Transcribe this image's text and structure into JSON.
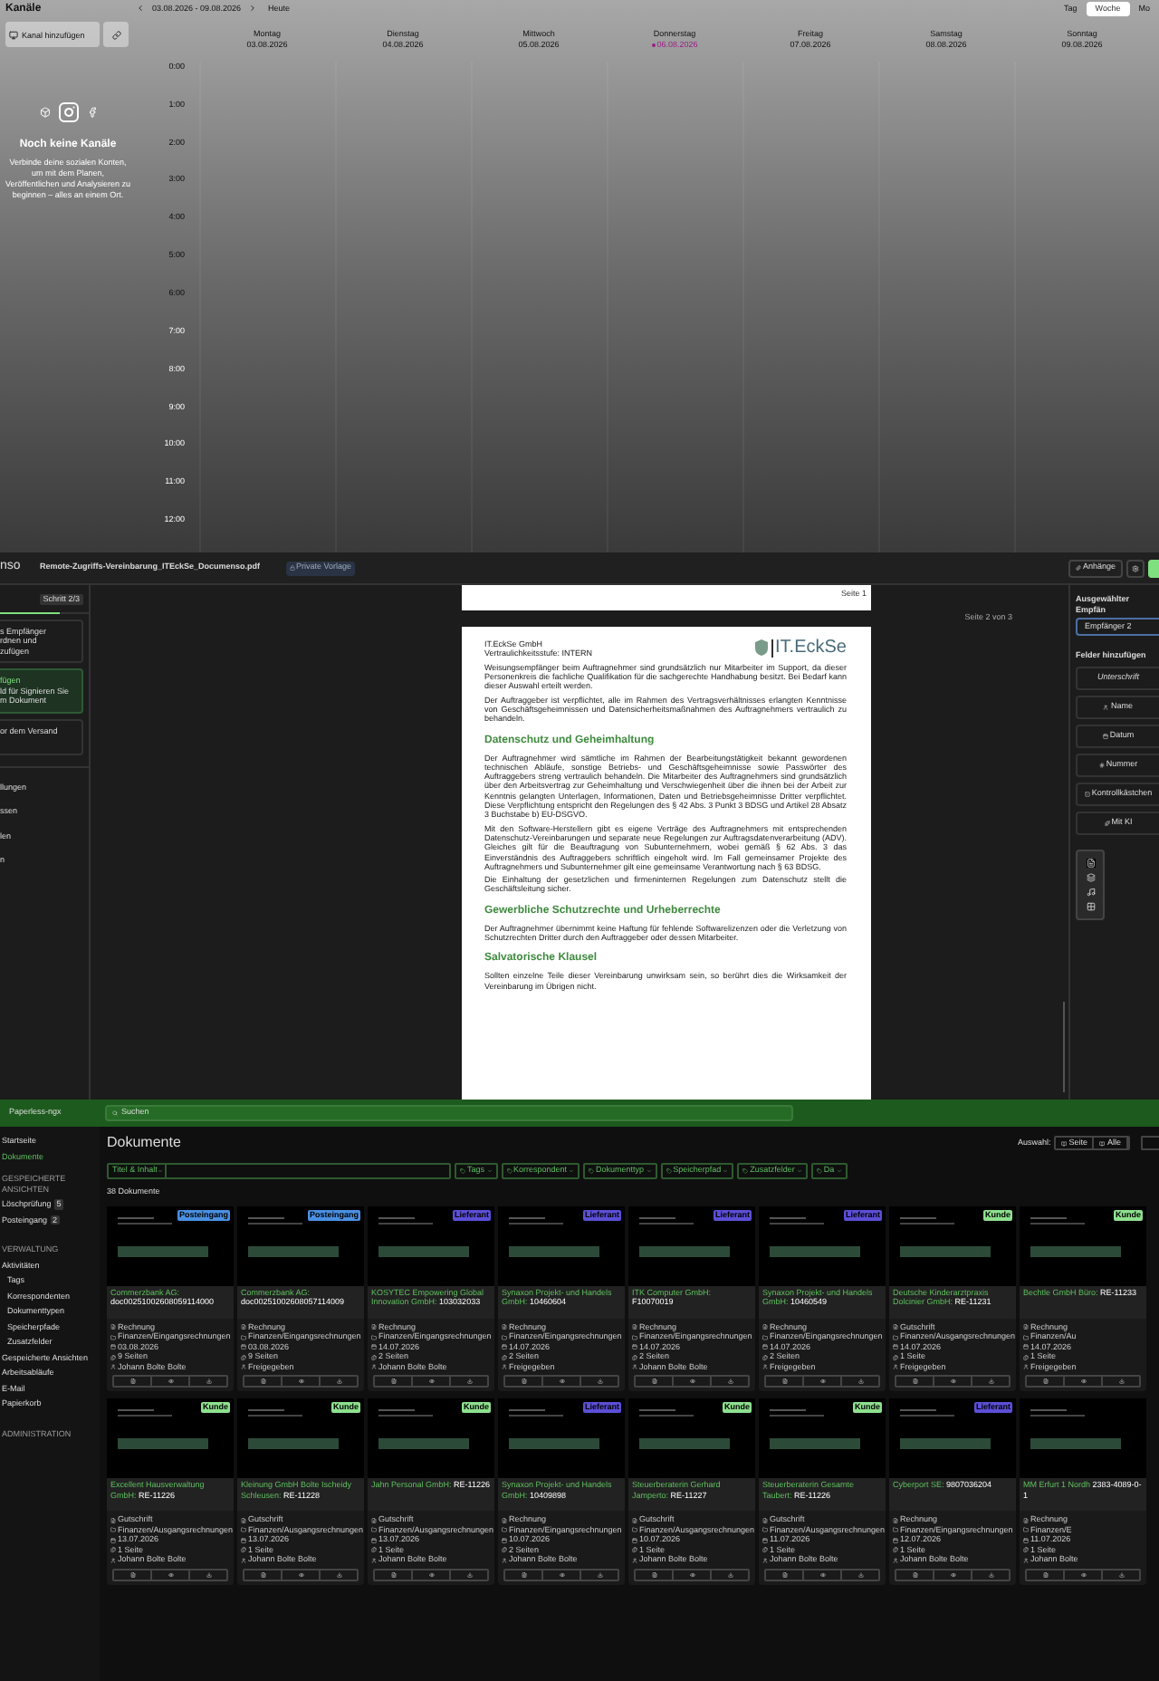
{
  "calendar": {
    "sidebar": {
      "title": "Kanäle",
      "add_button": "Kanal hinzufügen",
      "empty_title": "Noch keine Kanäle",
      "empty_text": "Verbinde deine sozialen Konten, um mit dem Planen, Veröffentlichen und Analysieren zu beginnen – alles an einem Ort."
    },
    "range": "03.08.2026 - 09.08.2026",
    "today_button": "Heute",
    "views": [
      {
        "label": "Tag",
        "selected": false
      },
      {
        "label": "Woche",
        "selected": true
      },
      {
        "label": "Mo",
        "selected": false
      }
    ],
    "days": [
      {
        "name": "Montag",
        "date": "03.08.2026",
        "today": false
      },
      {
        "name": "Dienstag",
        "date": "04.08.2026",
        "today": false
      },
      {
        "name": "Mittwoch",
        "date": "05.08.2026",
        "today": false
      },
      {
        "name": "Donnerstag",
        "date": "06.08.2026",
        "today": true
      },
      {
        "name": "Freitag",
        "date": "07.08.2026",
        "today": false
      },
      {
        "name": "Samstag",
        "date": "08.08.2026",
        "today": false
      },
      {
        "name": "Sonntag",
        "date": "09.08.2026",
        "today": false
      }
    ],
    "hours": [
      "0:00",
      "1:00",
      "2:00",
      "3:00",
      "4:00",
      "5:00",
      "6:00",
      "7:00",
      "8:00",
      "9:00",
      "10:00",
      "11:00",
      "12:00"
    ]
  },
  "editor": {
    "logo": "nso",
    "file_name": "Remote-Zugriffs-Vereinbarung_ITEckSe_Documenso.pdf",
    "badge": "Private Vorlage",
    "step": {
      "label": "Schritt 2/3",
      "level": 0.67
    },
    "steps": [
      {
        "lines": [
          "s Empfänger",
          "rdnen und",
          "zufügen"
        ],
        "selected": false
      },
      {
        "lines": [
          "fügen",
          "ld für Signieren Sie",
          "m Dokument"
        ],
        "selected": true
      },
      {
        "lines": [
          "or dem Versand"
        ],
        "selected": false
      }
    ],
    "menu": [
      "llungen",
      "ssen",
      "len",
      "n"
    ],
    "attachments_button": "Anhänge",
    "page_label": "Seite 2 von 3",
    "prev_page_label": "Seite 1",
    "doc": {
      "company": "IT.EckSe GmbH",
      "classification": "Vertraulichkeitsstufe: INTERN",
      "logo": "IT.EckSe",
      "blocks": [
        {
          "kind": "text",
          "text": "Weisungsempfänger beim Auftragnehmer sind grundsätzlich nur Mitarbeiter im Support, da dieser Personenkreis die fachliche Qualifikation für die sachgerechte Handhabung besitzt. Bei Bedarf kann dieser Auswahl erteilt werden."
        },
        {
          "kind": "text",
          "text": "Der Auftraggeber ist verpflichtet, alle im Rahmen des Vertragsverhältnisses erlangten Kenntnisse von Geschäftsgeheimnissen und Datensicherheitsmaßnahmen des Auftragnehmers vertraulich zu behandeln."
        },
        {
          "kind": "heading",
          "text": "Datenschutz und Geheimhaltung"
        },
        {
          "kind": "text",
          "text": "Der Auftragnehmer wird sämtliche im Rahmen der Bearbeitungstätigkeit bekannt gewordenen technischen Abläufe, sonstige Betriebs- und Geschäftsgeheimnisse sowie Passwörter des Auftraggebers streng vertraulich behandeln. Die Mitarbeiter des Auftragnehmers sind grundsätzlich über den Arbeitsvertrag zur Geheimhaltung und Verschwiegenheit über die ihnen bei der Arbeit zur Kenntnis gelangten Unterlagen, Informationen, Daten und Betriebsgeheimnisse Dritter verpflichtet. Diese Verpflichtung entspricht den Regelungen des § 42 Abs. 3 Punkt 3 BDSG und Artikel 28 Absatz 3 Buchstabe b) EU-DSGVO."
        },
        {
          "kind": "text",
          "text": "Mit den Software-Herstellern gibt es eigene Verträge des Auftragnehmers mit entsprechenden Datenschutz-Vereinbarungen und separate neue Regelungen zur Auftragsdatenverarbeitung (ADV). Gleiches gilt für die Beauftragung von Subunternehmern, wobei gemäß § 62 Abs. 3 das Einverständnis des Auftraggebers schriftlich eingeholt wird. Im Fall gemeinsamer Projekte des Auftragnehmers und Subunternehmer gilt eine gemeinsame Verantwortung nach § 63 BDSG."
        },
        {
          "kind": "text",
          "text": "Die Einhaltung der gesetzlichen und firmeninternen Regelungen zum Datenschutz stellt die Geschäftsleitung sicher."
        },
        {
          "kind": "heading",
          "text": "Gewerbliche Schutzrechte und Urheberrechte"
        },
        {
          "kind": "text",
          "text": "Der Auftragnehmer übernimmt keine Haftung für fehlende Softwarelizenzen oder die Verletzung von Schutzrechten Dritter durch den Auftraggeber oder dessen Mitarbeiter."
        },
        {
          "kind": "heading",
          "text": "Salvatorische Klausel"
        },
        {
          "kind": "text",
          "text": "Sollten einzelne Teile dieser Vereinbarung unwirksam sein, so berührt dies die Wirksamkeit der Vereinbarung im Übrigen nicht."
        }
      ]
    },
    "recipient_label": "Ausgewählter Empfän",
    "recipient": "Empfänger 2",
    "fields_label": "Felder hinzufügen",
    "fields": [
      {
        "kind": "signature",
        "label": "Unterschrift"
      },
      {
        "kind": "name",
        "label": "Name"
      },
      {
        "kind": "date",
        "label": "Datum"
      },
      {
        "kind": "number",
        "label": "Nummer"
      },
      {
        "kind": "checkbox",
        "label": "Kontrollkästchen"
      },
      {
        "kind": "ai",
        "label": "Mit KI"
      }
    ]
  },
  "paperless": {
    "brand": "Paperless-ngx",
    "search_placeholder": "Suchen",
    "nav": [
      {
        "kind": "item",
        "label": "Startseite",
        "selected": false
      },
      {
        "kind": "item",
        "label": "Dokumente",
        "selected": true
      },
      {
        "kind": "heading",
        "label": "GESPEICHERTE ANSICHTEN"
      },
      {
        "kind": "item",
        "label": "Löschprüfung",
        "count": "5",
        "selected": false
      },
      {
        "kind": "item",
        "label": "Posteingang",
        "count": "2",
        "selected": false
      },
      {
        "kind": "heading",
        "label": "VERWALTUNG"
      },
      {
        "kind": "item",
        "label": "Aktivitäten",
        "selected": false
      },
      {
        "kind": "sub",
        "label": "Tags",
        "selected": false
      },
      {
        "kind": "sub",
        "label": "Korrespondenten",
        "selected": false
      },
      {
        "kind": "sub",
        "label": "Dokumenttypen",
        "selected": false
      },
      {
        "kind": "sub",
        "label": "Speicherpfade",
        "selected": false
      },
      {
        "kind": "sub",
        "label": "Zusatzfelder",
        "selected": false
      },
      {
        "kind": "item",
        "label": "Gespeicherte Ansichten",
        "selected": false
      },
      {
        "kind": "item",
        "label": "Arbeitsabläufe",
        "selected": false
      },
      {
        "kind": "item",
        "label": "E-Mail",
        "selected": false
      },
      {
        "kind": "item",
        "label": "Papierkorb",
        "selected": false
      },
      {
        "kind": "heading",
        "label": "ADMINISTRATION"
      }
    ],
    "title": "Dokumente",
    "selection_label": "Auswahl:",
    "selection_buttons": [
      "Seite",
      "Alle"
    ],
    "title_filter": "Titel & Inhalt",
    "filters": [
      "Tags",
      "Korrespondent",
      "Dokumenttyp",
      "Speicherpfad",
      "Zusatzfelder",
      "Da"
    ],
    "count": "38 Dokumente",
    "cards": [
      {
        "badge": "Posteingang",
        "color": "#4a90e2",
        "title": "Commerzbank AG:",
        "number": "doc00251002608059114000",
        "type": "Rechnung",
        "path": "Finanzen/Eingangsrechnungen",
        "date": "03.08.2026",
        "pages": "9 Seiten",
        "owner": "Johann Bolte Bolte"
      },
      {
        "badge": "Posteingang",
        "color": "#4a90e2",
        "title": "Commerzbank AG:",
        "number": "doc00251002608057114009",
        "type": "Rechnung",
        "path": "Finanzen/Eingangsrechnungen",
        "date": "03.08.2026",
        "pages": "9 Seiten",
        "owner": "Freigegeben"
      },
      {
        "badge": "Lieferant",
        "color": "#5b4fd6",
        "title": "KOSYTEC Empowering Global Innovation GmbH:",
        "number": "103032033",
        "type": "Rechnung",
        "path": "Finanzen/Eingangsrechnungen",
        "date": "14.07.2026",
        "pages": "2 Seiten",
        "owner": "Johann Bolte Bolte"
      },
      {
        "badge": "Lieferant",
        "color": "#5b4fd6",
        "title": "Synaxon Projekt- und Handels GmbH:",
        "number": "10460604",
        "type": "Rechnung",
        "path": "Finanzen/Eingangsrechnungen",
        "date": "14.07.2026",
        "pages": "2 Seiten",
        "owner": "Freigegeben"
      },
      {
        "badge": "Lieferant",
        "color": "#5b4fd6",
        "title": "ITK Computer GmbH:",
        "number": "F10070019",
        "type": "Rechnung",
        "path": "Finanzen/Eingangsrechnungen",
        "date": "14.07.2026",
        "pages": "2 Seiten",
        "owner": "Johann Bolte Bolte"
      },
      {
        "badge": "Lieferant",
        "color": "#5b4fd6",
        "title": "Synaxon Projekt- und Handels GmbH:",
        "number": "10460549",
        "type": "Rechnung",
        "path": "Finanzen/Eingangsrechnungen",
        "date": "14.07.2026",
        "pages": "2 Seiten",
        "owner": "Freigegeben"
      },
      {
        "badge": "Kunde",
        "color": "#8ee08e",
        "title": "Deutsche Kinderarztpraxis Dolcinier GmbH:",
        "number": "RE-11231",
        "type": "Gutschrift",
        "path": "Finanzen/Ausgangsrechnungen",
        "date": "14.07.2026",
        "pages": "1 Seite",
        "owner": "Freigegeben"
      },
      {
        "badge": "Kunde",
        "color": "#8ee08e",
        "title": "Bechtle GmbH Büro:",
        "number": "RE-11233",
        "type": "Rechnung",
        "path": "Finanzen/Au",
        "date": "14.07.2026",
        "pages": "1 Seite",
        "owner": "Freigegeben"
      },
      {
        "badge": "Kunde",
        "color": "#8ee08e",
        "title": "Excellent Hausverwaltung GmbH:",
        "number": "RE-11226",
        "type": "Gutschrift",
        "path": "Finanzen/Ausgangsrechnungen",
        "date": "13.07.2026",
        "pages": "1 Seite",
        "owner": "Johann Bolte Bolte"
      },
      {
        "badge": "Kunde",
        "color": "#8ee08e",
        "title": "Kleinung GmbH Bolte Ischeidy Schleusen:",
        "number": "RE-11228",
        "type": "Gutschrift",
        "path": "Finanzen/Ausgangsrechnungen",
        "date": "13.07.2026",
        "pages": "1 Seite",
        "owner": "Johann Bolte Bolte"
      },
      {
        "badge": "Kunde",
        "color": "#8ee08e",
        "title": "Jahn Personal GmbH:",
        "number": "RE-11226",
        "type": "Gutschrift",
        "path": "Finanzen/Ausgangsrechnungen",
        "date": "13.07.2026",
        "pages": "1 Seite",
        "owner": "Johann Bolte Bolte"
      },
      {
        "badge": "Lieferant",
        "color": "#5b4fd6",
        "title": "Synaxon Projekt- und Handels GmbH:",
        "number": "10409898",
        "type": "Rechnung",
        "path": "Finanzen/Eingangsrechnungen",
        "date": "10.07.2026",
        "pages": "2 Seiten",
        "owner": "Johann Bolte Bolte"
      },
      {
        "badge": "Kunde",
        "color": "#8ee08e",
        "title": "Steuerberaterin Gerhard Jamperto:",
        "number": "RE-11227",
        "type": "Gutschrift",
        "path": "Finanzen/Ausgangsrechnungen",
        "date": "10.07.2026",
        "pages": "1 Seite",
        "owner": "Johann Bolte Bolte"
      },
      {
        "badge": "Kunde",
        "color": "#8ee08e",
        "title": "Steuerberaterin Gesamte Taubert:",
        "number": "RE-11226",
        "type": "Gutschrift",
        "path": "Finanzen/Ausgangsrechnungen",
        "date": "11.07.2026",
        "pages": "1 Seite",
        "owner": "Johann Bolte Bolte"
      },
      {
        "badge": "Lieferant",
        "color": "#5b4fd6",
        "title": "Cyberport SE:",
        "number": "9807036204",
        "type": "Rechnung",
        "path": "Finanzen/Eingangsrechnungen",
        "date": "12.07.2026",
        "pages": "1 Seite",
        "owner": "Johann Bolte Bolte"
      },
      {
        "title": "MM Erfurt 1 Nordh",
        "number": "2383-4089-0-1",
        "type": "Rechnung",
        "path": "Finanzen/E",
        "date": "11.07.2026",
        "pages": "1 Seite",
        "owner": "Johann Bolte"
      }
    ]
  }
}
